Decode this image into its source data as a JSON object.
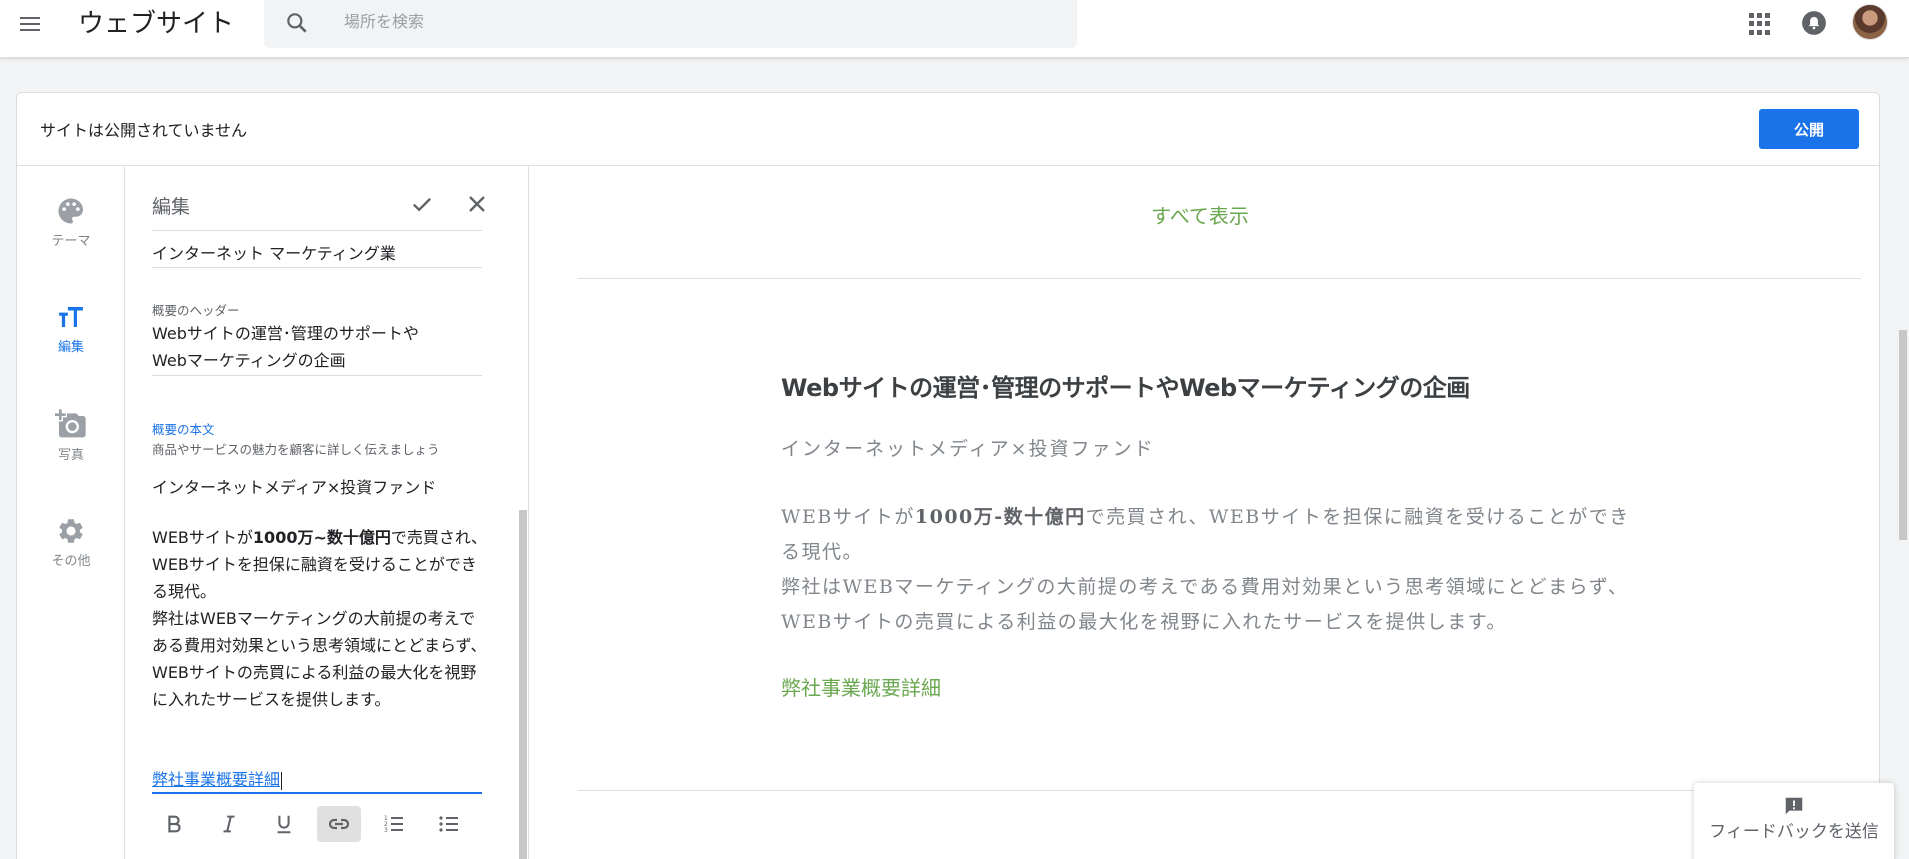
{
  "topbar": {
    "app_title": "ウェブサイト",
    "search_placeholder": "場所を検索"
  },
  "status": {
    "text": "サイトは公開されていません",
    "publish_label": "公開"
  },
  "rail": [
    {
      "label": "テーマ",
      "icon": "palette-icon",
      "active": false
    },
    {
      "label": "編集",
      "icon": "text-format-icon",
      "active": true
    },
    {
      "label": "写真",
      "icon": "add-photo-icon",
      "active": false
    },
    {
      "label": "その他",
      "icon": "gear-icon",
      "active": false
    }
  ],
  "editor": {
    "title": "編集",
    "business_field": "インターネット マーケティング業",
    "header_label": "概要のヘッダー",
    "header_line1": "Webサイトの運営･管理のサポートや",
    "header_line2": "Webマーケティングの企画",
    "body_label": "概要の本文",
    "body_hint": "商品やサービスの魅力を顧客に詳しく伝えましょう",
    "body_sub": "インターネットメディア×投資ファンド",
    "body_p1_pre": "WEBサイトが",
    "body_p1_bold": "1000万~数十億円",
    "body_p1_post": "で売買され、WEBサイトを担保に融資を受けることができる現代。",
    "body_p2": "弊社はWEBマーケティングの大前提の考えである費用対効果という思考領域にとどまらず、WEBサイトの売買による利益の最大化を視野に入れたサービスを提供します。",
    "link_text": "弊社事業概要詳細",
    "toolbar": [
      "bold",
      "italic",
      "underline",
      "link",
      "numbered-list",
      "bulleted-list"
    ]
  },
  "preview": {
    "see_all": "すべて表示",
    "heading": "Webサイトの運営･管理のサポートやWebマーケティングの企画",
    "sub": "インターネットメディア×投資ファンド",
    "p1_pre": "WEBサイトが",
    "p1_bold": "1000万-数十億円",
    "p1_post": "で売買され、WEBサイトを担保に融資を受けることができる現代。",
    "p2": "弊社はWEBマーケティングの大前提の考えである費用対効果という思考領域にとどまらず、WEBサイトの売買による利益の最大化を視野に入れたサービスを提供します。",
    "link_text": "弊社事業概要詳細"
  },
  "feedback": {
    "label": "フィードバックを送信"
  },
  "colors": {
    "accent": "#1a73e8",
    "link_green": "#6aa84f"
  }
}
